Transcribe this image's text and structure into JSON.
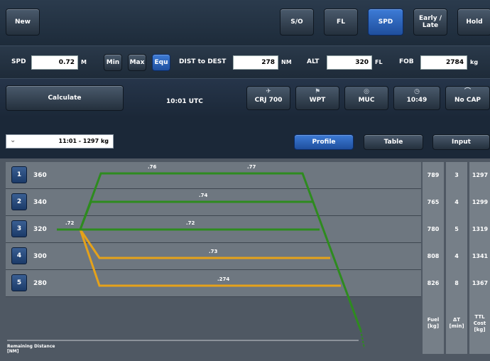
{
  "top": {
    "new": "New",
    "sio": "S/O",
    "fl": "FL",
    "spd": "SPD",
    "early_late": "Early / Late",
    "hold": "Hold"
  },
  "inputs": {
    "spd_label": "SPD",
    "spd_value": "0.72",
    "spd_unit": "M",
    "min": "Min",
    "max": "Max",
    "equ": "Equ",
    "dist_label": "DIST to DEST",
    "dist_value": "278",
    "dist_unit": "NM",
    "alt_label": "ALT",
    "alt_value": "320",
    "alt_unit": "FL",
    "fob_label": "FOB",
    "fob_value": "2784",
    "fob_unit": "kg"
  },
  "calc": {
    "calculate": "Calculate",
    "utc": "10:01 UTC",
    "aircraft": "CRJ 700",
    "wpt": "WPT",
    "muc": "MUC",
    "time": "10:49",
    "nocap": "No CAP"
  },
  "tabs": {
    "selector": "11:01 - 1297 kg",
    "profile": "Profile",
    "table": "Table",
    "input": "Input"
  },
  "rows": [
    {
      "num": "1",
      "fl": "360",
      "fuel": "789",
      "dt": "3",
      "cost": "1297"
    },
    {
      "num": "2",
      "fl": "340",
      "fuel": "765",
      "dt": "4",
      "cost": "1299"
    },
    {
      "num": "3",
      "fl": "320",
      "fuel": "780",
      "dt": "5",
      "cost": "1319"
    },
    {
      "num": "4",
      "fl": "300",
      "fuel": "808",
      "dt": "4",
      "cost": "1341"
    },
    {
      "num": "5",
      "fl": "280",
      "fuel": "826",
      "dt": "8",
      "cost": "1367"
    }
  ],
  "mach": [
    ".76",
    ".77",
    ".74",
    ".72",
    ".72",
    ".73",
    ".274"
  ],
  "headers": {
    "fuel": "Fuel [kg]",
    "dt": "ΔT [min]",
    "cost": "TTL Cost [kg]"
  },
  "remaining": "Remaining Distance [NM]",
  "colors": {
    "green": "#2e8b1f",
    "orange": "#e5a21a",
    "accent": "#2a62b8"
  }
}
